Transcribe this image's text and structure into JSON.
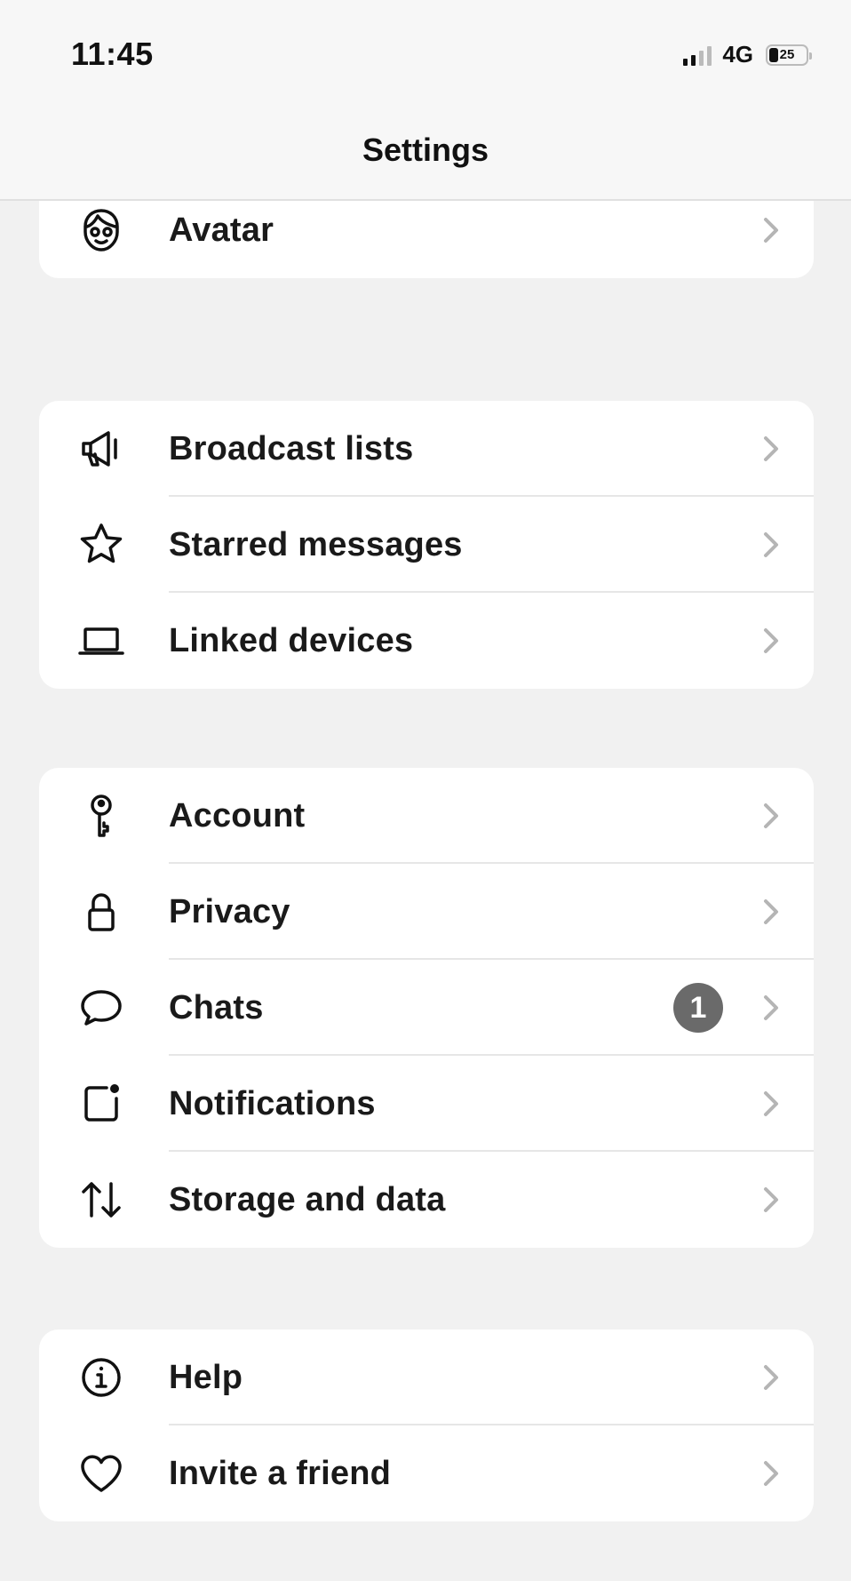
{
  "status_bar": {
    "time": "11:45",
    "network": "4G",
    "battery": "25"
  },
  "nav": {
    "title": "Settings"
  },
  "groups": [
    {
      "items": [
        {
          "label": "Avatar",
          "icon": "avatar-icon"
        }
      ]
    },
    {
      "items": [
        {
          "label": "Broadcast lists",
          "icon": "megaphone-icon"
        },
        {
          "label": "Starred messages",
          "icon": "star-icon"
        },
        {
          "label": "Linked devices",
          "icon": "laptop-icon"
        }
      ]
    },
    {
      "items": [
        {
          "label": "Account",
          "icon": "key-icon"
        },
        {
          "label": "Privacy",
          "icon": "lock-icon"
        },
        {
          "label": "Chats",
          "icon": "chat-bubble-icon",
          "badge": "1"
        },
        {
          "label": "Notifications",
          "icon": "notification-icon"
        },
        {
          "label": "Storage and data",
          "icon": "arrows-up-down-icon"
        }
      ]
    },
    {
      "items": [
        {
          "label": "Help",
          "icon": "info-icon"
        },
        {
          "label": "Invite a friend",
          "icon": "heart-icon"
        }
      ]
    }
  ],
  "colors": {
    "background": "#f1f1f1",
    "card": "#ffffff",
    "badge": "#6a6a6a",
    "chevron": "#b5b5b5"
  }
}
